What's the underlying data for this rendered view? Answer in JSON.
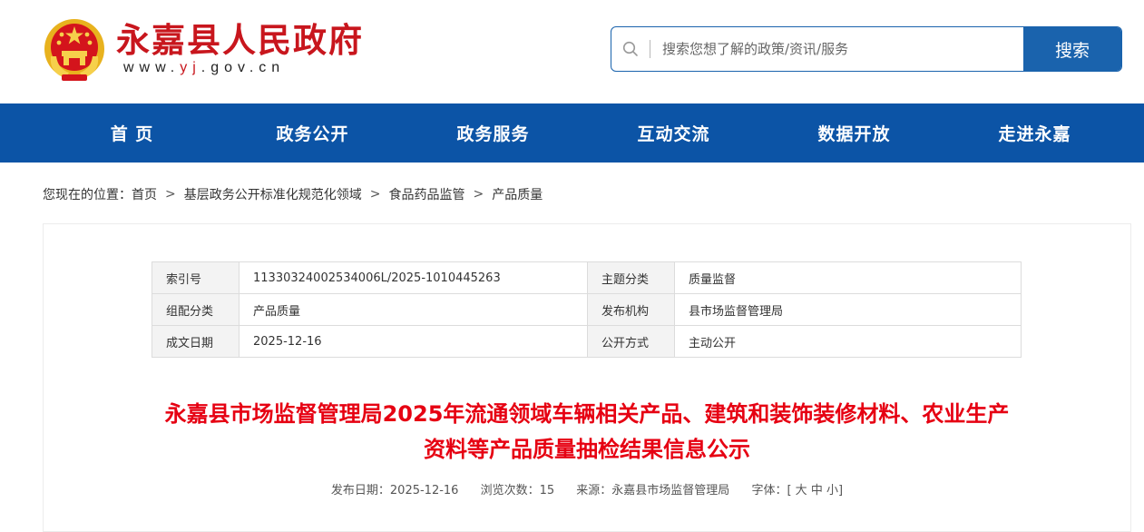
{
  "header": {
    "site_name": "永嘉县人民政府",
    "url_prefix": "www.",
    "url_accent": "yj",
    "url_suffix": ".gov.cn",
    "emblem_icon": "national-emblem-icon"
  },
  "search": {
    "placeholder": "搜索您想了解的政策/资讯/服务",
    "value": "",
    "button_label": "搜索",
    "icon": "search-icon"
  },
  "nav": {
    "items": [
      {
        "label": "首 页"
      },
      {
        "label": "政务公开"
      },
      {
        "label": "政务服务"
      },
      {
        "label": "互动交流"
      },
      {
        "label": "数据开放"
      },
      {
        "label": "走进永嘉"
      }
    ]
  },
  "breadcrumb": {
    "prefix": "您现在的位置：",
    "items": [
      {
        "label": "首页"
      },
      {
        "label": "基层政务公开标准化规范化领域"
      },
      {
        "label": "食品药品监管"
      },
      {
        "label": "产品质量"
      }
    ],
    "separator": ">"
  },
  "meta_table": {
    "rows": [
      [
        {
          "label": "索引号",
          "value": "11330324002534006L/2025-1010445263"
        },
        {
          "label": "主题分类",
          "value": "质量监督"
        }
      ],
      [
        {
          "label": "组配分类",
          "value": "产品质量"
        },
        {
          "label": "发布机构",
          "value": "县市场监督管理局"
        }
      ],
      [
        {
          "label": "成文日期",
          "value": "2025-12-16"
        },
        {
          "label": "公开方式",
          "value": "主动公开"
        }
      ]
    ]
  },
  "article": {
    "title_line1": "永嘉县市场监督管理局2025年流通领域车辆相关产品、建筑和装饰装修材料、农业生产",
    "title_line2": "资料等产品质量抽检结果信息公示",
    "publish_date": "发布日期：2025-12-16",
    "views": "浏览次数：15",
    "source": "来源：永嘉县市场监督管理局",
    "font_size_prefix": "字体：[",
    "font_large": "大",
    "font_medium": "中",
    "font_small": "小",
    "font_size_suffix": "]"
  },
  "colors": {
    "brand_red": "#c8161d",
    "title_red": "#e60012",
    "nav_blue": "#0c54a6",
    "button_blue": "#1a63ad"
  }
}
